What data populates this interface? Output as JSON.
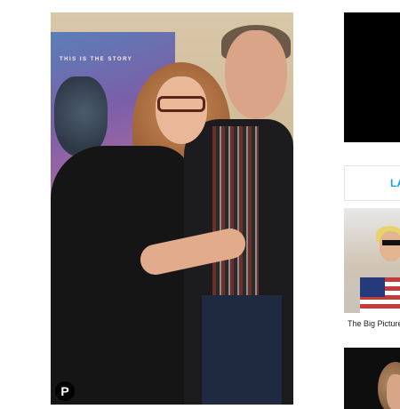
{
  "main_photo": {
    "poster_text": "THIS IS THE STORY",
    "share_icon": "pinterest-icon",
    "share_glyph": "P"
  },
  "sidebar": {
    "section_label": "LA",
    "article_caption": "The Big Picture:"
  },
  "colors": {
    "accent": "#1ea3dc",
    "ad_block": "#000000"
  }
}
